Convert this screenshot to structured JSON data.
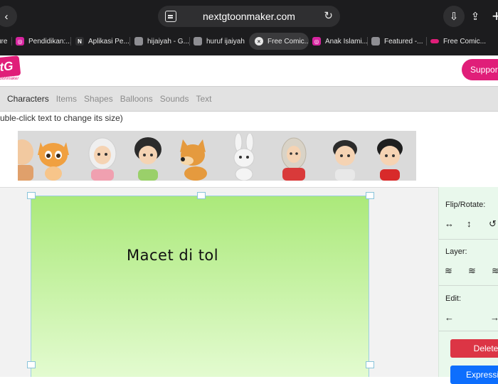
{
  "browser": {
    "url": "nextgtoonmaker.com",
    "tabs": [
      {
        "label": "ure",
        "icon": "folder-icon",
        "color": "#3a3a3c"
      },
      {
        "label": "Pendidikan:...",
        "icon": "instagram-icon",
        "color": "#d6249f"
      },
      {
        "label": "Aplikasi Pe...",
        "icon": "n-icon",
        "color": "#2f2f31"
      },
      {
        "label": "hijaiyah - G...",
        "icon": "page-icon",
        "color": "#8e8e93"
      },
      {
        "label": "huruf ijaiyah",
        "icon": "page-icon",
        "color": "#8e8e93"
      },
      {
        "label": "Free Comic...",
        "icon": "close-icon",
        "color": "#3a3a3c",
        "active": true
      },
      {
        "label": "Anak Islami...",
        "icon": "instagram-icon",
        "color": "#d6249f"
      },
      {
        "label": "Featured -...",
        "icon": "page-icon",
        "color": "#8e8e93"
      },
      {
        "label": "Free Comic...",
        "icon": "comic-icon",
        "color": "#e01e79"
      }
    ]
  },
  "site": {
    "logo_text": "tG",
    "logo_sub": "toonmaker",
    "support_label": "Support",
    "menu": [
      "Characters",
      "Items",
      "Shapes",
      "Balloons",
      "Sounds",
      "Text"
    ],
    "active_menu": "Characters",
    "hint": "uble-click text to change its size)"
  },
  "characters": [
    {
      "name": "partial-character",
      "color": "#e0a06b"
    },
    {
      "name": "orange-cat",
      "color": "#f0a040"
    },
    {
      "name": "hijab-girl",
      "color": "#f0a0b0"
    },
    {
      "name": "green-shirt-girl",
      "color": "#9ad06a"
    },
    {
      "name": "orange-dog",
      "color": "#e59a3e"
    },
    {
      "name": "white-rabbit",
      "color": "#f4f4f4"
    },
    {
      "name": "hijab-woman-red",
      "color": "#d93a3a"
    },
    {
      "name": "boy-white-shirt",
      "color": "#e8e8e8"
    },
    {
      "name": "boy-red-shirt",
      "color": "#d82a2a"
    }
  ],
  "canvas": {
    "text": "Macet di tol"
  },
  "side_panel": {
    "flip_rotate_label": "Flip/Rotate:",
    "flip_icons": [
      "flip-horizontal-icon",
      "flip-vertical-icon",
      "rotate-icon"
    ],
    "layer_label": "Layer:",
    "layer_icons": [
      "layer-down-icon",
      "layer-icon",
      "layer-up-icon"
    ],
    "edit_label": "Edit:",
    "edit_icons": [
      "arrow-left-icon",
      "arrow-right-icon"
    ],
    "delete_label": "Delete",
    "expressions_label": "Expressio"
  },
  "colors": {
    "brand": "#e01e79",
    "canvas_top": "#abe97a",
    "canvas_bottom": "#e3fbd0",
    "panel": "#e9f8ec",
    "delete": "#dc3545",
    "expressions": "#0d6efd"
  }
}
